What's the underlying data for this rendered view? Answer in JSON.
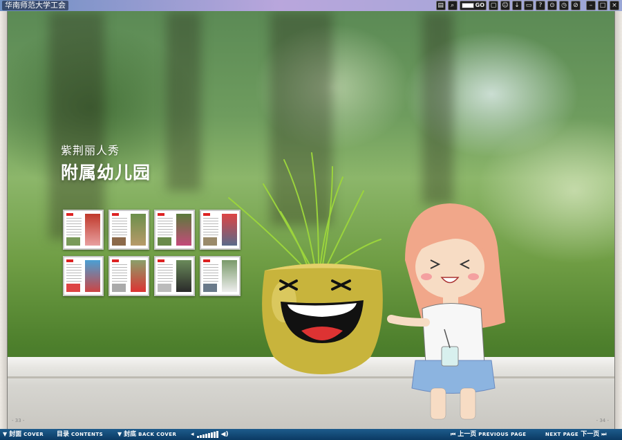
{
  "app": {
    "title": "华南师范大学工会"
  },
  "toolbar": {
    "go_label": "GO",
    "icons": [
      "book-icon",
      "zoom-icon",
      "page-input",
      "comment-icon",
      "share-icon",
      "download-icon",
      "print-icon",
      "help-icon",
      "settings-icon",
      "autoplay-icon",
      "clear-icon",
      "minimize-icon",
      "maximize-icon",
      "close-icon"
    ]
  },
  "page": {
    "subtitle": "紫荆丽人秀",
    "title": "附属幼儿园",
    "left_page_number": "- 33 -",
    "right_page_number": "- 34 -"
  },
  "nav": {
    "cover_cn": "封面",
    "cover_en": "COVER",
    "contents_cn": "目录",
    "contents_en": "CONTENTS",
    "back_cover_cn": "封底",
    "back_cover_en": "BACK COVER",
    "previous_cn": "上一页",
    "previous_en": "PREVIOUS PAGE",
    "next_en": "NEXT PAGE",
    "next_cn": "下一页",
    "volume_level": 0.85
  },
  "colors": {
    "accent_nav": "#0b3a63",
    "title_bar": "#b9a6dc",
    "page_tag": "#dd2222"
  }
}
